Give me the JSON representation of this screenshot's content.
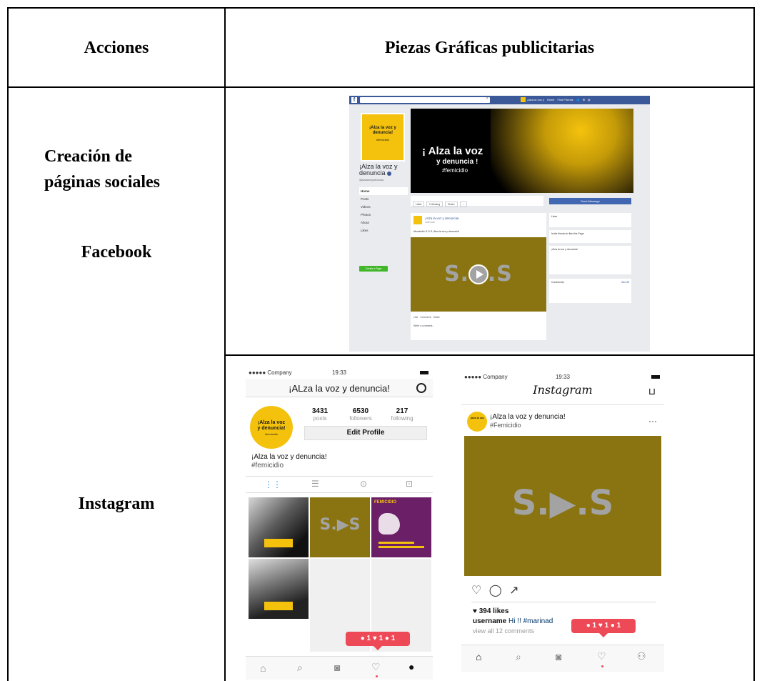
{
  "table": {
    "header_actions": "Acciones",
    "header_pieces": "Piezas Gráficas publicitarias",
    "row1_line1": "Creación de",
    "row1_line2": "páginas sociales",
    "row1_platform": "Facebook",
    "row2_platform": "Instagram"
  },
  "facebook_mock": {
    "logo": "f",
    "nav_items": [
      "¡Alza la voz y",
      "Home",
      "Find Friends"
    ],
    "profile_logo_line1": "¡Alza la voz y",
    "profile_logo_line2": "denuncia!",
    "profile_logo_tag": "#femicidio",
    "page_name_line1": "¡Alza la voz y",
    "page_name_line2": "denuncia",
    "handle": "@alzalavozydenuncia",
    "menu": [
      "Home",
      "Posts",
      "Videos",
      "Photos",
      "About",
      "Likes"
    ],
    "create_page": "Create a Page",
    "cover_title": "¡ Alza la voz",
    "cover_subtitle": "y denuncia !",
    "cover_tag": "#femicidio",
    "actions": [
      "Liked",
      "Following",
      "Share",
      "..."
    ],
    "send_message": "Send Message",
    "post_name": "¡Alza la voz y denuncia!",
    "post_time": "Just now",
    "post_text": "#femicidio S.O.S ¡Alza la voz y denuncia!",
    "video_text": "S.O.S",
    "post_like": "Like",
    "post_comment": "Comment",
    "post_share": "Share",
    "post_foot": "Write a comment...",
    "right_box1": "Likes",
    "right_box2": "Invite friends to like this Page",
    "right_box3": "¡Alza la voz y denuncia!",
    "right_box4": "Community",
    "right_box4_link": "See All"
  },
  "instagram_profile": {
    "carrier": "●●●●● Company",
    "time": "19:33",
    "title": "¡ALza la voz y denuncia!",
    "avatar_line1": "¡Alza la voz",
    "avatar_line2": "y denuncia!",
    "avatar_tag": "#femicidio",
    "posts_count": "3431",
    "posts_label": "posts",
    "followers_count": "6530",
    "followers_label": "followers",
    "following_count": "217",
    "following_label": "following",
    "edit_profile": "Edit Profile",
    "bio_name": "¡Alza la voz y denuncia!",
    "bio_tag": "#femicidio",
    "grid_video_text": "S.▶S",
    "femicidio_label": "FEMICIDIO",
    "notif": "● 1  ♥ 1  ● 1"
  },
  "instagram_feed": {
    "carrier": "●●●●● Company",
    "time": "19:33",
    "app_title": "Instagram",
    "user_name": "¡Alza la voz y denuncia!",
    "user_tag": "#Femicidio",
    "more": "···",
    "video_text": "S.▶.S",
    "likes": "♥ 394 likes",
    "caption_user": "username",
    "caption_text": "Hi !! #marinad",
    "comments": "view all 12 comments",
    "notif": "● 1  ♥ 1  ● 1"
  }
}
